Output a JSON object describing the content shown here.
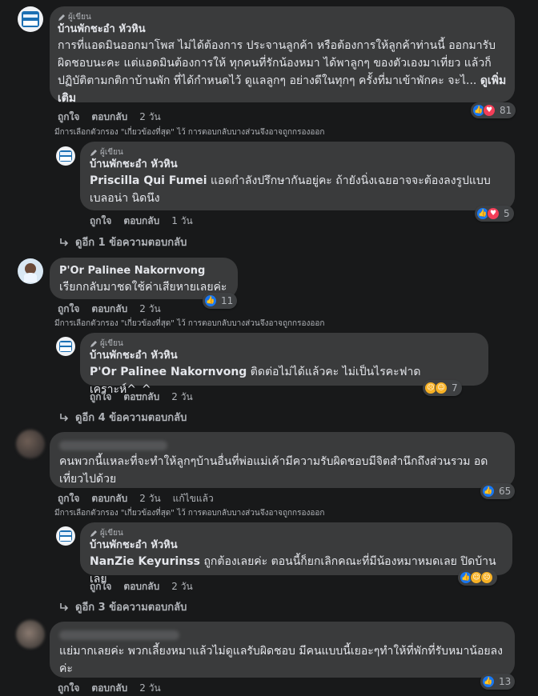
{
  "author_tag": "ผู้เขียน",
  "page_name": "บ้านพักชะอำ หัวหิน",
  "filter_note": "มีการเลือกตัวกรอง \"เกี่ยวข้องที่สุด\" ไว้ การตอบกลับบางส่วนจึงอาจถูกกรองออก",
  "labels": {
    "like": "ถูกใจ",
    "reply": "ตอบกลับ",
    "edited": "แก้ไขแล้ว"
  },
  "colors": {
    "background": "#18191a",
    "bubble": "#3a3b3c",
    "like_blue": "#1877f2",
    "heart_red": "#f33e58"
  },
  "comments": [
    {
      "name": "บ้านพักชะอำ หัวหิน",
      "text": "การที่แอดมินออกมาโพส ไม่ได้ต้องการ ประจานลูกค้า หรือต้องการให้ลูกค้าท่านนี้ ออกมารับผิดชอบนะคะ แต่แอดมินต้องการให้ ทุกคนที่รักน้องหมา ได้พาลูกๆ ของตัวเองมาเที่ยว แล้วก็ปฏิบัติตามกติกาบ้านพัก ที่ได้กำหนดไว้ ดูแลลูกๆ อย่างดีในทุกๆ ครั้งที่มาเข้าพักคะ จะไ...",
      "see_more": "ดูเพิ่มเติม",
      "time": "2 วัน",
      "reactions": "81",
      "reply": {
        "name": "บ้านพักชะอำ หัวหิน",
        "mention": "Priscilla Qui Fumei",
        "text": "แอดกำลังปรึกษากันอยู่คะ ถ้ายังนิ่งเฉยอาจจะต้องลงรูปแบบเบลอน่า นิดนึง",
        "time": "1 วัน",
        "reactions": "5"
      },
      "more_replies": "ดูอีก 1 ข้อความตอบกลับ"
    },
    {
      "name": "P'Or Palinee Nakornvong",
      "text": "เรียกกลับมาชดใช้ค่าเสียหายเลยค่ะ",
      "time": "2 วัน",
      "reactions": "11",
      "reply": {
        "name": "บ้านพักชะอำ หัวหิน",
        "mention": "P'Or Palinee Nakornvong",
        "text": "ติดต่อไม่ได้แล้วคะ ไม่เป็นไรคะฟาดเคราะห์^_^",
        "time": "2 วัน",
        "reactions": "7"
      },
      "more_replies": "ดูอีก 4 ข้อความตอบกลับ"
    },
    {
      "text": "คนพวกนี้แหละที่จะทำให้ลูกๆบ้านอื่นที่พ่อแม่เค้ามีความรับผิดชอบมีจิตสำนึกถึงส่วนรวม อดเที่ยวไปด้วย",
      "time": "2 วัน",
      "reactions": "65",
      "reply": {
        "name": "บ้านพักชะอำ หัวหิน",
        "mention": "NanZie Keyurinss",
        "text": "ถูกต้องเลยค่ะ ตอนนี้ก็ยกเลิกคณะที่มีน้องหมาหมดเลย ปิดบ้านเลย",
        "time": "2 วัน",
        "reactions": ""
      },
      "more_replies": "ดูอีก 3 ข้อความตอบกลับ"
    },
    {
      "text": "แย่มากเลยค่ะ พวกเลี้ยงหมาแล้วไม่ดูแลรับผิดชอบ มีคนแบบนี้เยอะๆทำให้ที่พักที่รับหมาน้อยลงค่ะ",
      "time": "2 วัน",
      "reactions": "13"
    }
  ]
}
